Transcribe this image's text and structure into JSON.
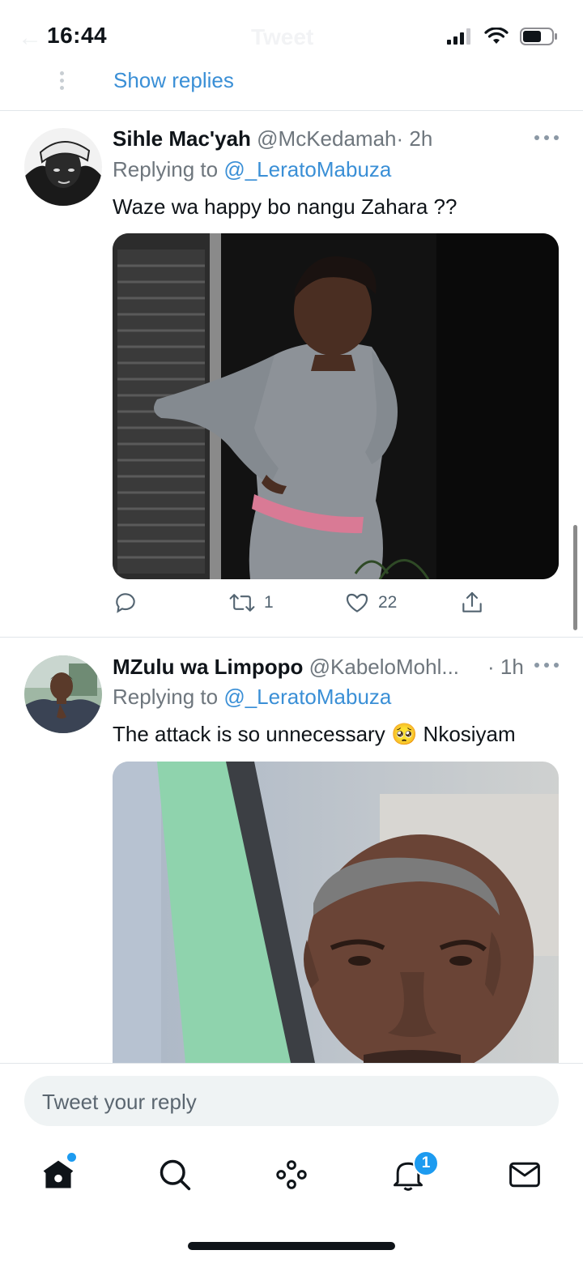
{
  "status_bar": {
    "time": "16:44"
  },
  "header": {
    "ghost_title": "Tweet"
  },
  "thread": {
    "show_replies_label": "Show replies"
  },
  "tweets": [
    {
      "name": "Sihle Mac'yah",
      "handle": "@McKedamah",
      "time": "· 2h",
      "replying_prefix": "Replying to ",
      "replying_to": "@_LeratoMabuza",
      "text": "Waze wa happy bo nangu Zahara  ??",
      "actions": {
        "replies": "",
        "retweets": "1",
        "likes": "22"
      }
    },
    {
      "name": "MZulu wa Limpopo",
      "handle": "@KabeloMohl...",
      "time": "· 1h",
      "replying_prefix": "Replying to ",
      "replying_to": "@_LeratoMabuza",
      "text": "The attack is so unnecessary 🥺 Nkosiyam"
    }
  ],
  "reply": {
    "placeholder": "Tweet your reply"
  },
  "tabbar": {
    "items": [
      "home-icon",
      "search-icon",
      "spaces-icon",
      "notifications-icon",
      "messages-icon"
    ],
    "notifications_badge": "1"
  },
  "colors": {
    "accent": "#1d9bf0",
    "link": "#3a8fd6",
    "muted": "#6e767d"
  }
}
